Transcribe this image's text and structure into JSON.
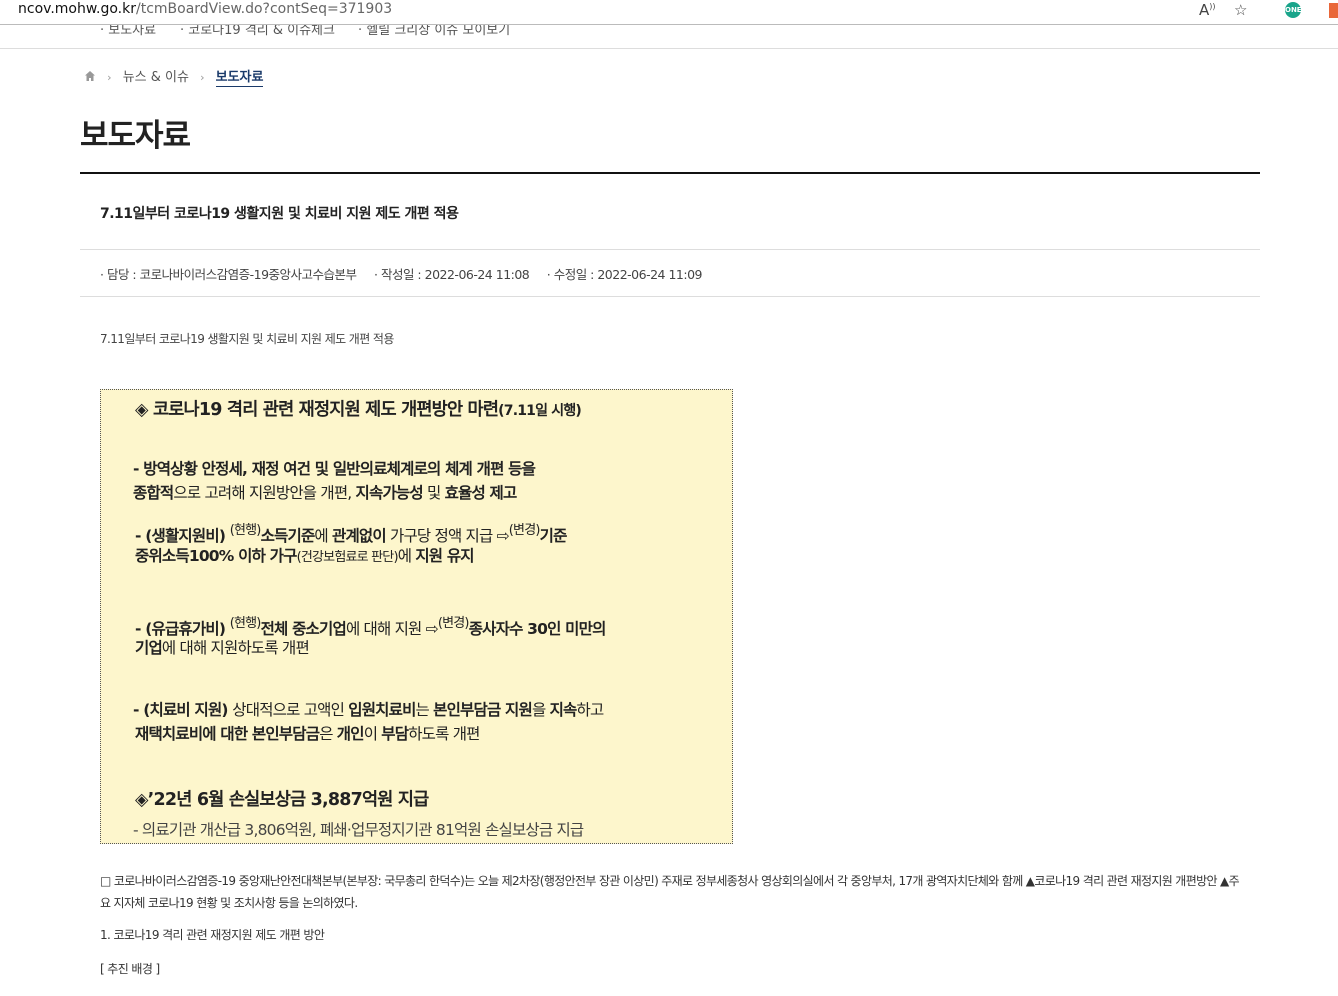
{
  "browser": {
    "url_domain": "ncov.mohw.go.kr",
    "url_path": "/tcmBoardView.do?contSeq=371903",
    "ext1_label": "ONE"
  },
  "topnav": [
    "· 보도자료",
    "· 코로나19 격리 & 이슈체크",
    "· 헬릴 크리상 이슈 모이보기"
  ],
  "breadcrumb": {
    "section": "뉴스 & 이슈",
    "current": "보도자료"
  },
  "page_title": "보도자료",
  "post": {
    "title": "7.11일부터 코로나19 생활지원 및 치료비 지원 제도 개편 적용",
    "meta": {
      "manager": "· 담당 : 코로나바이러스감염증-19중앙사고수습본부",
      "created": "· 작성일 : 2022-06-24 11:08",
      "modified": "· 수정일 : 2022-06-24 11:09"
    },
    "lead": "7.11일부터 코로나19 생활지원 및 치료비 지원 제도 개편 적용"
  },
  "box": {
    "title_main": "◈ 코로나19 격리 관련 재정지원 제도 개편방안 마련",
    "title_sub": "(7.11일 시행)",
    "p1a": "- 방역상황 안정세, 재정 여건 및 일반의료체계로의 체계 개편 등을",
    "p1b_1": "종합적",
    "p1b_2": "으로 고려해 지원방안을 개편, ",
    "p1b_3": "지속가능성",
    "p1b_4": " 및 ",
    "p1b_5": "효율성 제고",
    "p2_1": "- (생활지원비) ",
    "p2_sup1": "(현행)",
    "p2_2": "소득기준",
    "p2_3": "에 ",
    "p2_4": "관계없이",
    "p2_5": " 가구당 정액 지급 ⇨",
    "p2_sup2": "(변경)",
    "p2_6": "기준",
    "p2b_1": "중위소득100% 이하 가구",
    "p2b_2": "(건강보험료로 판단)",
    "p2b_3": "에 ",
    "p2b_4": "지원 유지",
    "p3_1": "- (유급휴가비) ",
    "p3_sup1": "(현행)",
    "p3_2": "전체 중소기업",
    "p3_3": "에 대해 지원 ⇨",
    "p3_sup2": "(변경)",
    "p3_4": "종사자수 30인 미만의",
    "p3b_1": "기업",
    "p3b_2": "에 대해 지원하도록 개편",
    "p4_1": "- (치료비 지원) ",
    "p4_2": "상대적으로 고액인 ",
    "p4_3": "입원치료비",
    "p4_4": "는 ",
    "p4_5": "본인부담금 지원",
    "p4_6": "을 ",
    "p4_7": "지속",
    "p4_8": "하고",
    "p4b_1": "재택치료비에 대한 본인부담금",
    "p4b_2": "은 ",
    "p4b_3": "개인",
    "p4b_4": "이 ",
    "p4b_5": "부담",
    "p4b_6": "하도록 개편",
    "title2": "◈’22년 6월 손실보상금 3,887억원 지급",
    "last": "- 의료기관 개산급 3,806억원, 폐쇄·업무정지기관 81억원 손실보상금 지급"
  },
  "body_paragraph": "□ 코로나바이러스감염증-19 중앙재난안전대책본부(본부장: 국무총리 한덕수)는 오늘 제2차장(행정안전부 장관 이상민) 주재로 정부세종청사 영상회의실에서 각 중앙부처, 17개 광역자치단체와 함께 ▲코로나19 격리 관련 재정지원 개편방안 ▲주요 지자체 코로나19 현황 및 조치사항 등을 논의하였다.",
  "section1": "1. 코로나19 격리 관련 재정지원 제도 개편 방안",
  "section2": "[ 추진 배경 ]"
}
